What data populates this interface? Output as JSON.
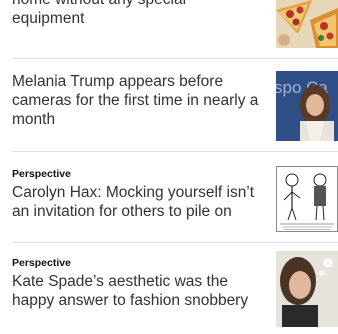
{
  "stories": [
    {
      "kicker": "",
      "headline_line1": "home without any special",
      "headline_line2": "equipment",
      "thumb_icon": "pizza-photo"
    },
    {
      "kicker": "",
      "headline": "Melania Trump appears before cameras for the first time in nearly a month",
      "thumb_icon": "melania-trump-photo",
      "thumb_caption": "spo Ca"
    },
    {
      "kicker": "Perspective",
      "headline": "Carolyn Hax: Mocking yourself isn’t an invitation for others to pile on",
      "thumb_icon": "cartoon-illustration"
    },
    {
      "kicker": "Perspective",
      "headline": "Kate Spade’s aesthetic was the happy answer to fashion snobbery",
      "thumb_icon": "kate-spade-photo"
    }
  ]
}
